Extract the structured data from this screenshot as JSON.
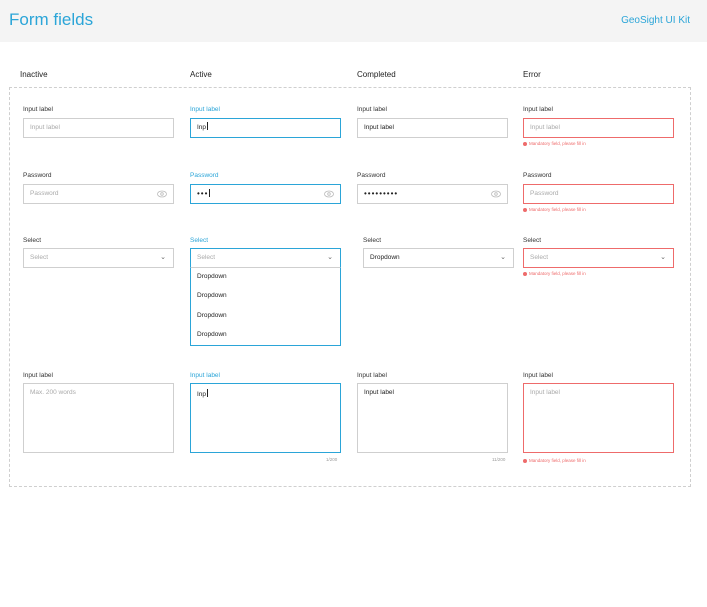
{
  "header": {
    "title": "Form fields",
    "kit": "GeoSight UI Kit"
  },
  "columns": [
    "Inactive",
    "Active",
    "Completed",
    "Error"
  ],
  "input_row": {
    "labels": [
      "Input label",
      "Input label",
      "Input label",
      "Input label"
    ],
    "inactive_placeholder": "Input label",
    "active_value": "Inp",
    "completed_value": "Input label",
    "error_placeholder": "Input label",
    "error_message": "Mandatory field, please fill in"
  },
  "password_row": {
    "labels": [
      "Password",
      "Password",
      "Password",
      "Password"
    ],
    "inactive_placeholder": "Password",
    "active_value": "•••",
    "completed_value": "•••••••••",
    "error_placeholder": "Password",
    "error_message": "Mandatory field, please fill in"
  },
  "select_row": {
    "labels": [
      "Select",
      "Select",
      "Select",
      "Select"
    ],
    "inactive_placeholder": "Select",
    "active_placeholder": "Select",
    "completed_value": "Dropdown",
    "error_placeholder": "Select",
    "error_message": "Mandatory field, please fill in",
    "options": [
      "Dropdown",
      "Dropdown",
      "Dropdown",
      "Dropdown"
    ]
  },
  "textarea_row": {
    "labels": [
      "Input label",
      "Input label",
      "Input label",
      "Input label"
    ],
    "inactive_placeholder": "Max. 200 words",
    "active_value": "Inp",
    "completed_value": "Input label",
    "error_placeholder": "Input label",
    "active_counter": "1/200",
    "completed_counter": "11/200",
    "error_message": "Mandatory field, please fill in"
  },
  "colors": {
    "accent": "#2ba5d8",
    "error": "#ee6b6b",
    "border": "#cfcfcf"
  },
  "icons": {
    "password_toggle": "eye-icon",
    "select": "chevron-down-icon",
    "error": "error-dot-icon"
  }
}
